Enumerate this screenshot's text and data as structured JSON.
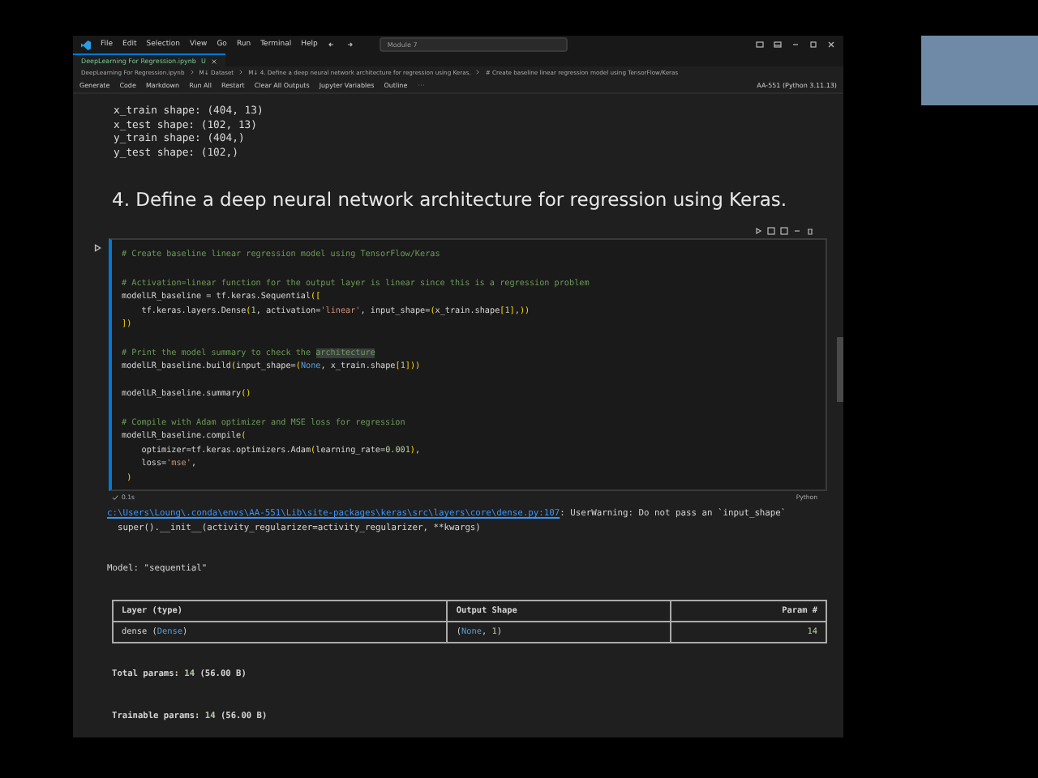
{
  "title_bar": {
    "menu": [
      "File",
      "Edit",
      "Selection",
      "View",
      "Go",
      "Run",
      "Terminal",
      "Help"
    ],
    "search": {
      "value": "Module 7"
    }
  },
  "tabs": [
    {
      "label": "DeepLearning For Regression.ipynb",
      "badge": "U",
      "selected": true
    }
  ],
  "breadcrumb": [
    "DeepLearning For Regression.ipynb",
    "M↓ Dataset",
    "M↓ 4. Define a deep neural network architecture for regression using Keras.",
    "# Create baseline linear regression model using TensorFlow/Keras"
  ],
  "toolbar": {
    "items": [
      "Generate",
      "Code",
      "Markdown",
      "Run All",
      "Restart",
      "Clear All Outputs",
      "Jupyter Variables",
      "Outline"
    ],
    "kernel": "AA-551 (Python 3.11.13)"
  },
  "previous_output": [
    "x_train shape: (404, 13)",
    "x_test shape: (102, 13)",
    "y_train shape: (404,)",
    "y_test shape: (102,)"
  ],
  "heading": "4. Define a deep neural network architecture for regression using Keras.",
  "code_cell": {
    "language": "Python",
    "status": "0.1s",
    "lines": [
      {
        "kind": "code",
        "tokens": [
          {
            "text": "# Create baseline linear regression model using TensorFlow/Keras",
            "kind": "comment"
          }
        ]
      },
      {
        "kind": "blank"
      },
      {
        "kind": "code",
        "tokens": [
          {
            "text": "# Activation=linear function for the output layer is linear since this is a regression problem",
            "kind": "comment"
          }
        ]
      },
      {
        "kind": "code",
        "tokens": [
          {
            "text": "modelLR_baseline = tf.keras.Sequential",
            "kind": "plain"
          },
          {
            "text": "([",
            "kind": "bracket"
          }
        ]
      },
      {
        "kind": "code",
        "tokens": [
          {
            "text": "    tf.keras.layers.Dense",
            "kind": "plain"
          },
          {
            "text": "(",
            "kind": "bracket"
          },
          {
            "text": "1",
            "kind": "number"
          },
          {
            "text": ", activation=",
            "kind": "plain"
          },
          {
            "text": "'linear'",
            "kind": "string"
          },
          {
            "text": ", input_shape=",
            "kind": "plain"
          },
          {
            "text": "(",
            "kind": "bracket"
          },
          {
            "text": "x_train.shape",
            "kind": "plain"
          },
          {
            "text": "[",
            "kind": "bracket"
          },
          {
            "text": "1",
            "kind": "number"
          },
          {
            "text": "]",
            "kind": "bracket"
          },
          {
            "text": ",",
            "kind": "plain"
          },
          {
            "text": "))",
            "kind": "bracket"
          }
        ]
      },
      {
        "kind": "code",
        "tokens": [
          {
            "text": "])",
            "kind": "bracket"
          }
        ]
      },
      {
        "kind": "blank"
      },
      {
        "kind": "code",
        "tokens": [
          {
            "text": "# Print the model summary to check the ",
            "kind": "comment"
          },
          {
            "text": "architecture",
            "kind": "highlight"
          }
        ]
      },
      {
        "kind": "code",
        "tokens": [
          {
            "text": "modelLR_baseline.build",
            "kind": "plain"
          },
          {
            "text": "(",
            "kind": "bracket"
          },
          {
            "text": "input_shape=",
            "kind": "plain"
          },
          {
            "text": "(",
            "kind": "bracket"
          },
          {
            "text": "None",
            "kind": "keyword"
          },
          {
            "text": ", x_train.shape",
            "kind": "plain"
          },
          {
            "text": "[",
            "kind": "bracket"
          },
          {
            "text": "1",
            "kind": "number"
          },
          {
            "text": "]",
            "kind": "bracket"
          },
          {
            "text": "))",
            "kind": "bracket"
          }
        ]
      },
      {
        "kind": "blank"
      },
      {
        "kind": "code",
        "tokens": [
          {
            "text": "modelLR_baseline.summary",
            "kind": "plain"
          },
          {
            "text": "()",
            "kind": "bracket"
          }
        ]
      },
      {
        "kind": "blank"
      },
      {
        "kind": "code",
        "tokens": [
          {
            "text": "# Compile with Adam optimizer and MSE loss for regression",
            "kind": "comment"
          }
        ]
      },
      {
        "kind": "code",
        "tokens": [
          {
            "text": "modelLR_baseline.compile",
            "kind": "plain"
          },
          {
            "text": "(",
            "kind": "bracket"
          }
        ]
      },
      {
        "kind": "code",
        "tokens": [
          {
            "text": "    optimizer=tf.keras.optimizers.Adam",
            "kind": "plain"
          },
          {
            "text": "(",
            "kind": "bracket"
          },
          {
            "text": "learning_rate=",
            "kind": "plain"
          },
          {
            "text": "0.001",
            "kind": "number"
          },
          {
            "text": ")",
            "kind": "bracket"
          },
          {
            "text": ",",
            "kind": "plain"
          }
        ]
      },
      {
        "kind": "code",
        "tokens": [
          {
            "text": "    loss=",
            "kind": "plain"
          },
          {
            "text": "'mse'",
            "kind": "string"
          },
          {
            "text": ",",
            "kind": "plain"
          }
        ]
      },
      {
        "kind": "code",
        "tokens": [
          {
            "text": " )",
            "kind": "bracket"
          }
        ]
      }
    ]
  },
  "output": {
    "warning": {
      "link": "c:\\Users\\Loung\\.conda\\envs\\AA-551\\Lib\\site-packages\\keras\\src\\layers\\core\\dense.py:107",
      "message": ": UserWarning: Do not pass an `input_shape`",
      "detail": "  super().__init__(activity_regularizer=activity_regularizer, **kwargs)"
    },
    "model_line": "Model: \"sequential\"",
    "table": {
      "columns": [
        "Layer (type)",
        "Output Shape",
        "Param #"
      ],
      "rows": [
        [
          [
            {
              "text": "dense (",
              "kind": "plain"
            },
            {
              "text": "Dense",
              "kind": "keyword"
            },
            {
              "text": ")",
              "kind": "plain"
            }
          ],
          [
            {
              "text": "(",
              "kind": "plain"
            },
            {
              "text": "None",
              "kind": "keyword"
            },
            {
              "text": ", ",
              "kind": "plain"
            },
            {
              "text": "1",
              "kind": "number"
            },
            {
              "text": ")",
              "kind": "plain"
            }
          ],
          [
            {
              "text": "14",
              "kind": "number"
            }
          ]
        ]
      ]
    },
    "totals": [
      [
        {
          "text": "Total params: ",
          "kind": "plain"
        },
        {
          "text": "14",
          "kind": "number"
        },
        {
          "text": " (56.00 B)",
          "kind": "plain"
        }
      ],
      [
        {
          "text": "Trainable params: ",
          "kind": "plain"
        },
        {
          "text": "14",
          "kind": "number"
        },
        {
          "text": " (56.00 B)",
          "kind": "plain"
        }
      ]
    ]
  }
}
